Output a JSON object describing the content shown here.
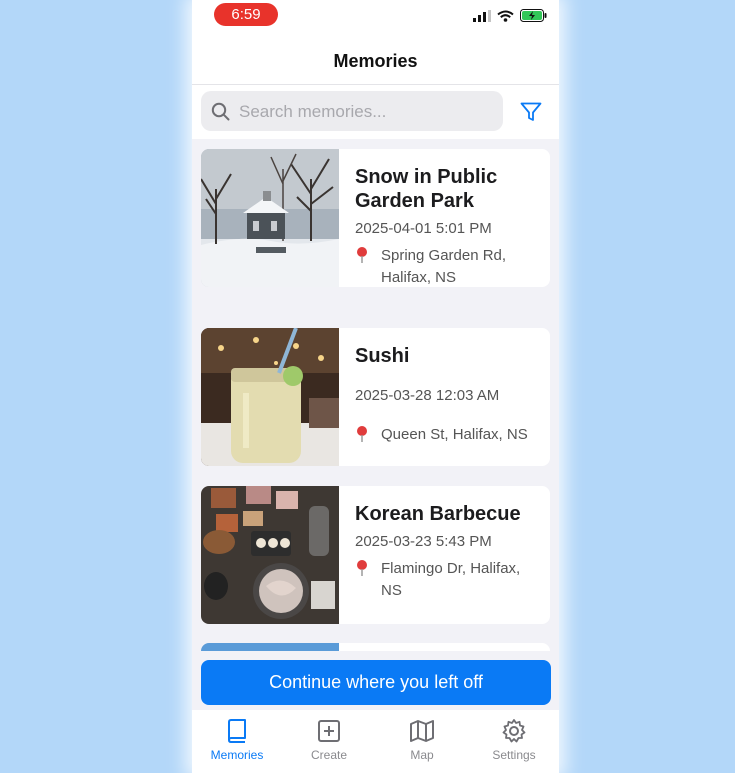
{
  "status_bar": {
    "time": "6:59"
  },
  "nav": {
    "title": "Memories"
  },
  "search": {
    "placeholder": "Search memories..."
  },
  "memories": [
    {
      "title_line1": "Snow in Public",
      "title_line2": "Garden Park",
      "date": "2025-04-01 5:01 PM",
      "location_line1": "Spring Garden Rd,",
      "location_line2": "Halifax, NS"
    },
    {
      "title": "Sushi",
      "date": "2025-03-28 12:03 AM",
      "location": "Queen St, Halifax, NS"
    },
    {
      "title": "Korean Barbecue",
      "date": "2025-03-23 5:43 PM",
      "location_line1": "Flamingo Dr, Halifax,",
      "location_line2": "NS"
    }
  ],
  "continue_button": {
    "label": "Continue where you left off"
  },
  "tabs": [
    {
      "label": "Memories",
      "icon": "book-icon",
      "active": true
    },
    {
      "label": "Create",
      "icon": "plus-square-icon"
    },
    {
      "label": "Map",
      "icon": "map-icon"
    },
    {
      "label": "Settings",
      "icon": "gear-icon"
    }
  ],
  "colors": {
    "accent": "#0a7af5",
    "time_pill": "#e8332b",
    "page_bg": "#f2f2f7"
  }
}
